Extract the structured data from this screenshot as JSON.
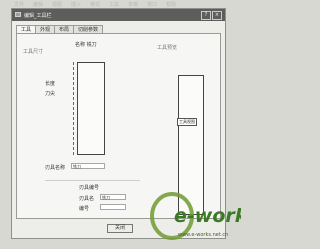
{
  "window": {
    "title": "编辑_工具栏",
    "help_glyph": "?",
    "close_glyph": "×"
  },
  "tabs": [
    "工具",
    "外观",
    "布局",
    "切削参数"
  ],
  "form": {
    "header": "名称  铣刀",
    "left_top_label": "工具尺寸",
    "right_top_label": "工具预览",
    "length_label": "长度",
    "dia_label": "刀尖",
    "field1_label": "刃具名称",
    "field1_value": "铣刀",
    "section_label": "刃具编号",
    "field2_label": "刃具名",
    "field2_value": "铣刀",
    "field3_label": "编号",
    "field3_value": "",
    "preview_tag": "工具视图"
  },
  "footer": {
    "ok_label": "关闭"
  },
  "watermark": {
    "main": "e-works",
    "sub": "www.e-works.net.cn"
  }
}
